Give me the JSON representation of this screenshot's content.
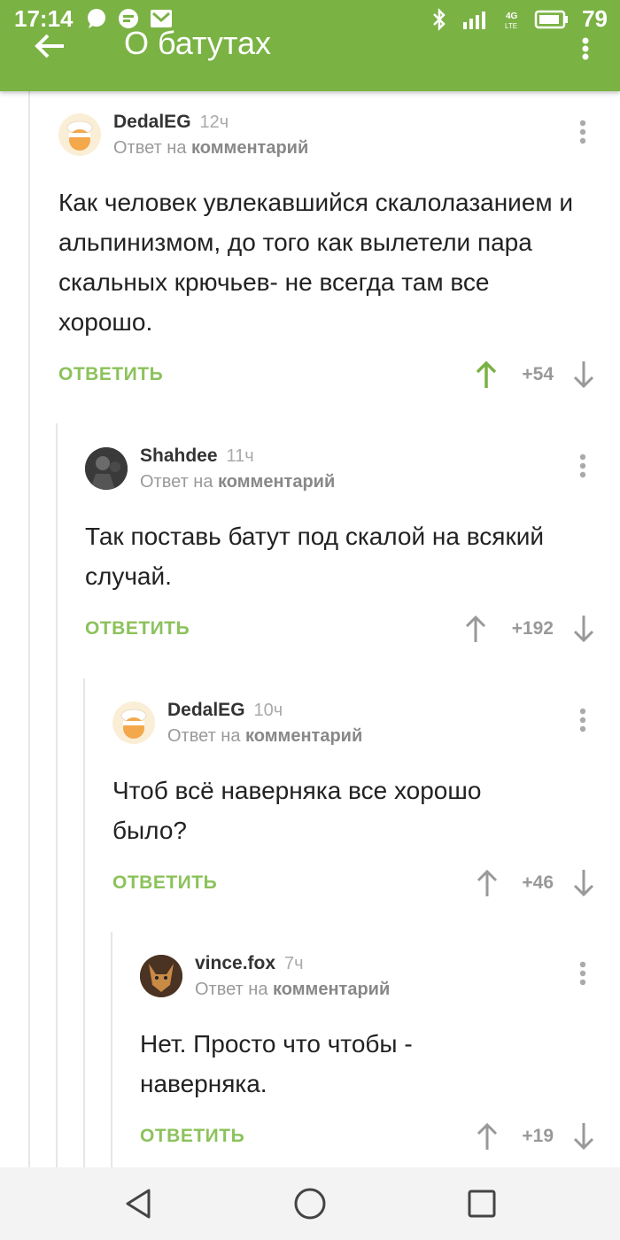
{
  "status_bar": {
    "time": "17:14",
    "battery": "79",
    "network": "4G LTE"
  },
  "header": {
    "title": "О батутах"
  },
  "comments": [
    {
      "user": "DedalEG",
      "time": "12ч",
      "reply_prefix": "Ответ на",
      "reply_target": "комментарий",
      "text": "Как человек увлекавшийся скалолазанием и альпинизмом, до того как вылетели пара скальных крючьев- не всегда там все хорошо.",
      "reply_label": "ОТВЕТИТЬ",
      "score": "+54",
      "upvoted": true
    },
    {
      "user": "Shahdee",
      "time": "11ч",
      "reply_prefix": "Ответ на",
      "reply_target": "комментарий",
      "text": "Так поставь батут под скалой на всякий случай.",
      "reply_label": "ОТВЕТИТЬ",
      "score": "+192",
      "upvoted": false
    },
    {
      "user": "DedalEG",
      "time": "10ч",
      "reply_prefix": "Ответ на",
      "reply_target": "комментарий",
      "text": "Чтоб всё наверняка все хорошо было?",
      "reply_label": "ОТВЕТИТЬ",
      "score": "+46",
      "upvoted": false
    },
    {
      "user": "vince.fox",
      "time": "7ч",
      "reply_prefix": "Ответ на",
      "reply_target": "комментарий",
      "text": "Нет. Просто что чтобы  - наверняка.",
      "reply_label": "ОТВЕТИТЬ",
      "score": "+19",
      "upvoted": false
    }
  ],
  "colors": {
    "brand": "#7ab244",
    "reply": "#8cc25b",
    "upvote_active": "#7ab244"
  }
}
